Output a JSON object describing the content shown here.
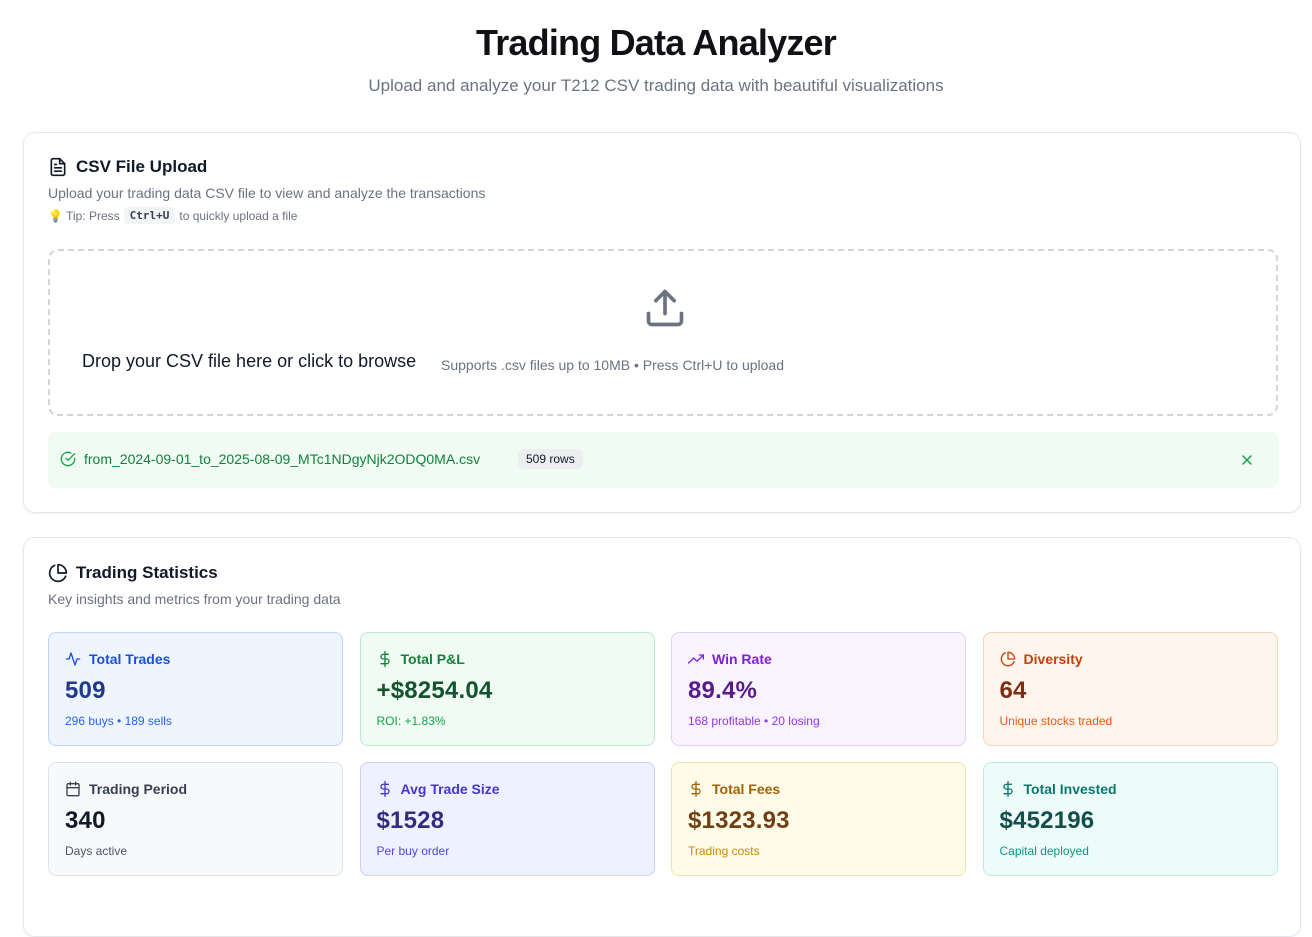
{
  "header": {
    "title": "Trading Data Analyzer",
    "subtitle": "Upload and analyze your T212 CSV trading data with beautiful visualizations"
  },
  "upload": {
    "title": "CSV File Upload",
    "description": "Upload your trading data CSV file to view and analyze the transactions",
    "tip_prefix": "💡 Tip: Press",
    "tip_key": "Ctrl+U",
    "tip_suffix": "to quickly upload a file",
    "dropzone_main": "Drop your CSV file here or click to browse",
    "dropzone_sub": "Supports .csv files up to 10MB • Press Ctrl+U to upload",
    "file_name": "from_2024-09-01_to_2025-08-09_MTc1NDgyNjk2ODQ0MA.csv",
    "file_rows": "509 rows"
  },
  "stats": {
    "title": "Trading Statistics",
    "description": "Key insights and metrics from your trading data",
    "cards": [
      {
        "icon": "activity-icon",
        "label": "Total Trades",
        "value": "509",
        "sub": "296 buys • 189 sells",
        "bg": "#eff5ff",
        "border": "#bfd3f6",
        "label_color": "#1d4ed8",
        "value_color": "#1e3a8a",
        "sub_color": "#2563eb"
      },
      {
        "icon": "dollar-icon",
        "label": "Total P&L",
        "value": "+$8254.04",
        "sub": "ROI: +1.83%",
        "bg": "#effbf3",
        "border": "#bde8cb",
        "label_color": "#15803d",
        "value_color": "#14532d",
        "sub_color": "#16a34a"
      },
      {
        "icon": "trending-up-icon",
        "label": "Win Rate",
        "value": "89.4%",
        "sub": "168 profitable • 20 losing",
        "bg": "#f9f3ff",
        "border": "#e2cff7",
        "label_color": "#7e22ce",
        "value_color": "#581c87",
        "sub_color": "#9333ea"
      },
      {
        "icon": "pie-chart-icon",
        "label": "Diversity",
        "value": "64",
        "sub": "Unique stocks traded",
        "bg": "#fff5ec",
        "border": "#f6d6bb",
        "label_color": "#c2410c",
        "value_color": "#7c2d12",
        "sub_color": "#ea580c"
      },
      {
        "icon": "calendar-icon",
        "label": "Trading Period",
        "value": "340",
        "sub": "Days active",
        "bg": "#f8f9fb",
        "border": "#dfe3e8",
        "label_color": "#374151",
        "value_color": "#111827",
        "sub_color": "#4b5563"
      },
      {
        "icon": "dollar-icon",
        "label": "Avg Trade Size",
        "value": "$1528",
        "sub": "Per buy order",
        "bg": "#eef1ff",
        "border": "#c9d0f7",
        "label_color": "#4338ca",
        "value_color": "#312e81",
        "sub_color": "#4f46e5"
      },
      {
        "icon": "dollar-icon",
        "label": "Total Fees",
        "value": "$1323.93",
        "sub": "Trading costs",
        "bg": "#fefbe9",
        "border": "#f1e2a8",
        "label_color": "#a16207",
        "value_color": "#713f12",
        "sub_color": "#ca8a04"
      },
      {
        "icon": "dollar-icon",
        "label": "Total Invested",
        "value": "$452196",
        "sub": "Capital deployed",
        "bg": "#edfcf9",
        "border": "#bfeae2",
        "label_color": "#0f766e",
        "value_color": "#134e4a",
        "sub_color": "#0d9488"
      }
    ]
  }
}
